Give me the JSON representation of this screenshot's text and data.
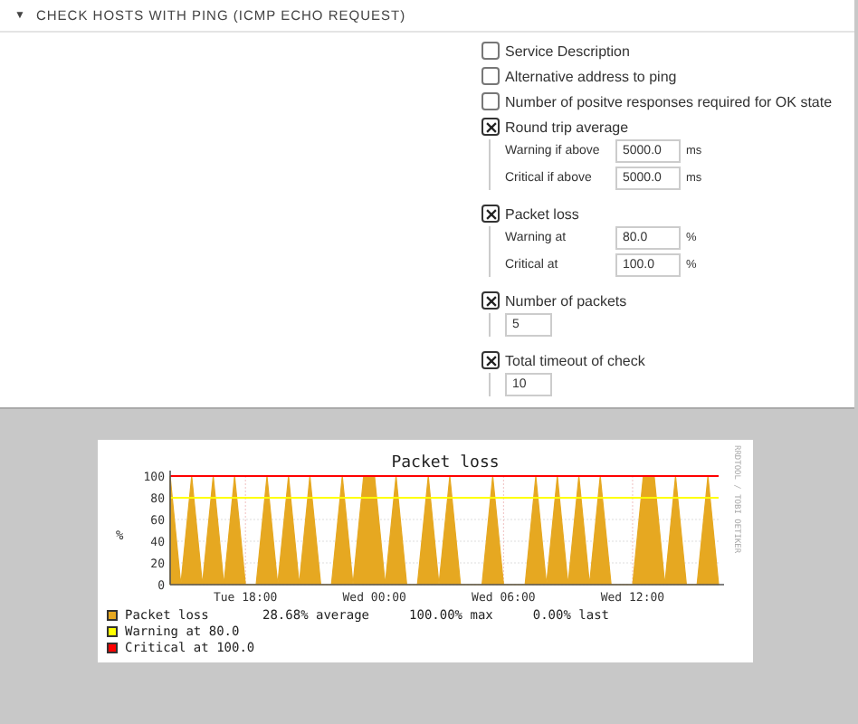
{
  "section": {
    "toggle": "▼",
    "title": "CHECK HOSTS WITH PING (ICMP ECHO REQUEST)"
  },
  "options": [
    {
      "label": "Service Description",
      "checked": false
    },
    {
      "label": "Alternative address to ping",
      "checked": false
    },
    {
      "label": "Number of positve responses required for OK state",
      "checked": false
    },
    {
      "label": "Round trip average",
      "checked": true,
      "fields": [
        {
          "label": "Warning if above",
          "value": "5000.0",
          "unit": "ms"
        },
        {
          "label": "Critical if above",
          "value": "5000.0",
          "unit": "ms"
        }
      ]
    },
    {
      "label": "Packet loss",
      "checked": true,
      "fields": [
        {
          "label": "Warning at",
          "value": "80.0",
          "unit": "%"
        },
        {
          "label": "Critical at",
          "value": "100.0",
          "unit": "%"
        }
      ]
    },
    {
      "label": "Number of packets",
      "checked": true,
      "fields": [
        {
          "value": "5"
        }
      ]
    },
    {
      "label": "Total timeout of check",
      "checked": true,
      "fields": [
        {
          "value": "10"
        }
      ]
    }
  ],
  "graph": {
    "side_text": "RRDTOOL / TOBI OETIKER",
    "legend_stats": [
      "28.68% average",
      "100.00% max",
      "0.00% last"
    ],
    "chart_data": {
      "type": "area",
      "title": "Packet loss",
      "ylabel": "%",
      "categories": [
        null,
        null,
        null,
        null,
        null,
        null,
        null,
        "Tue 18:00",
        null,
        null,
        null,
        null,
        null,
        null,
        null,
        null,
        null,
        null,
        null,
        "Wed 00:00",
        null,
        null,
        null,
        null,
        null,
        null,
        null,
        null,
        null,
        null,
        null,
        "Wed 06:00",
        null,
        null,
        null,
        null,
        null,
        null,
        null,
        null,
        null,
        null,
        null,
        "Wed 12:00",
        null,
        null,
        null,
        null,
        null,
        null,
        null,
        null
      ],
      "series": [
        {
          "name": "Packet loss",
          "color": "#e6a821",
          "values": [
            100,
            0,
            100,
            0,
            100,
            0,
            100,
            0,
            0,
            100,
            0,
            100,
            0,
            100,
            0,
            0,
            100,
            0,
            100,
            100,
            0,
            100,
            0,
            0,
            100,
            0,
            100,
            0,
            0,
            0,
            100,
            0,
            0,
            0,
            100,
            0,
            100,
            0,
            100,
            0,
            100,
            0,
            0,
            0,
            100,
            100,
            0,
            100,
            0,
            0,
            100,
            0
          ]
        },
        {
          "name": "Warning at 80.0",
          "type": "line",
          "color": "#ffff00",
          "values": [
            80,
            80,
            80,
            80,
            80,
            80,
            80,
            80,
            80,
            80,
            80,
            80,
            80,
            80,
            80,
            80,
            80,
            80,
            80,
            80,
            80,
            80,
            80,
            80,
            80,
            80,
            80,
            80,
            80,
            80,
            80,
            80,
            80,
            80,
            80,
            80,
            80,
            80,
            80,
            80,
            80,
            80,
            80,
            80,
            80,
            80,
            80,
            80,
            80,
            80,
            80,
            80
          ]
        },
        {
          "name": "Critical at 100.0",
          "type": "line",
          "color": "#ff0000",
          "values": [
            100,
            100,
            100,
            100,
            100,
            100,
            100,
            100,
            100,
            100,
            100,
            100,
            100,
            100,
            100,
            100,
            100,
            100,
            100,
            100,
            100,
            100,
            100,
            100,
            100,
            100,
            100,
            100,
            100,
            100,
            100,
            100,
            100,
            100,
            100,
            100,
            100,
            100,
            100,
            100,
            100,
            100,
            100,
            100,
            100,
            100,
            100,
            100,
            100,
            100,
            100,
            100
          ]
        }
      ],
      "grid": true,
      "ylim": [
        0,
        100
      ],
      "yticks": [
        0,
        20,
        40,
        60,
        80,
        100
      ]
    }
  }
}
